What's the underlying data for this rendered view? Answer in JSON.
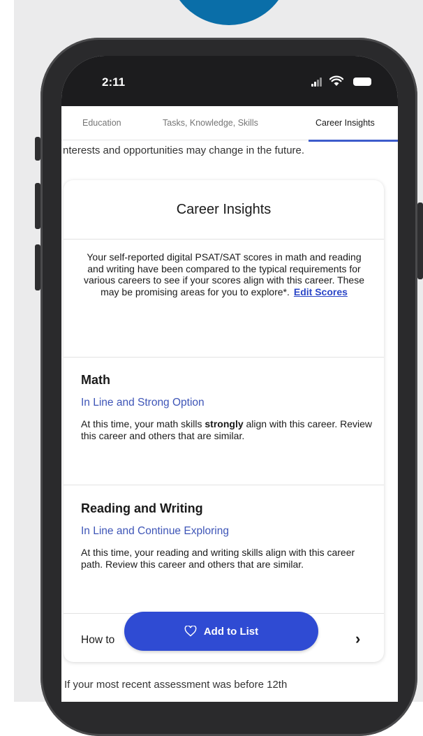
{
  "status_bar": {
    "time": "2:11"
  },
  "tabs": [
    {
      "label": "Education",
      "active": false
    },
    {
      "label": "Tasks, Knowledge, Skills",
      "active": false
    },
    {
      "label": "Career Insights",
      "active": true
    }
  ],
  "intro_text": "nterests and opportunities may change in the future.",
  "card": {
    "title": "Career Insights",
    "description": "Your self-reported digital PSAT/SAT scores in math and reading and writing have been compared to the typical requirements for various careers to see if your scores align with this career. These may be promising areas for you to explore*.",
    "edit_link": "Edit Scores",
    "math": {
      "title": "Math",
      "status": "In Line and Strong Option",
      "body_before": "At this time, your math skills ",
      "body_emphasis": "strongly",
      "body_after": " align with this career. Review this career and others that are similar."
    },
    "reading": {
      "title": "Reading and Writing",
      "status": "In Line and Continue Exploring",
      "body": "At this time, your reading and writing skills align with this career path. Review this career and others that are similar."
    },
    "how_to_label": "How to"
  },
  "add_button": {
    "label": "Add to List"
  },
  "footer_text": "If your most recent assessment was before 12th",
  "colors": {
    "accent": "#2f4bd3",
    "link": "#2b46c7",
    "status_text": "#3e55b7",
    "top_circle": "#0a6ea8"
  }
}
